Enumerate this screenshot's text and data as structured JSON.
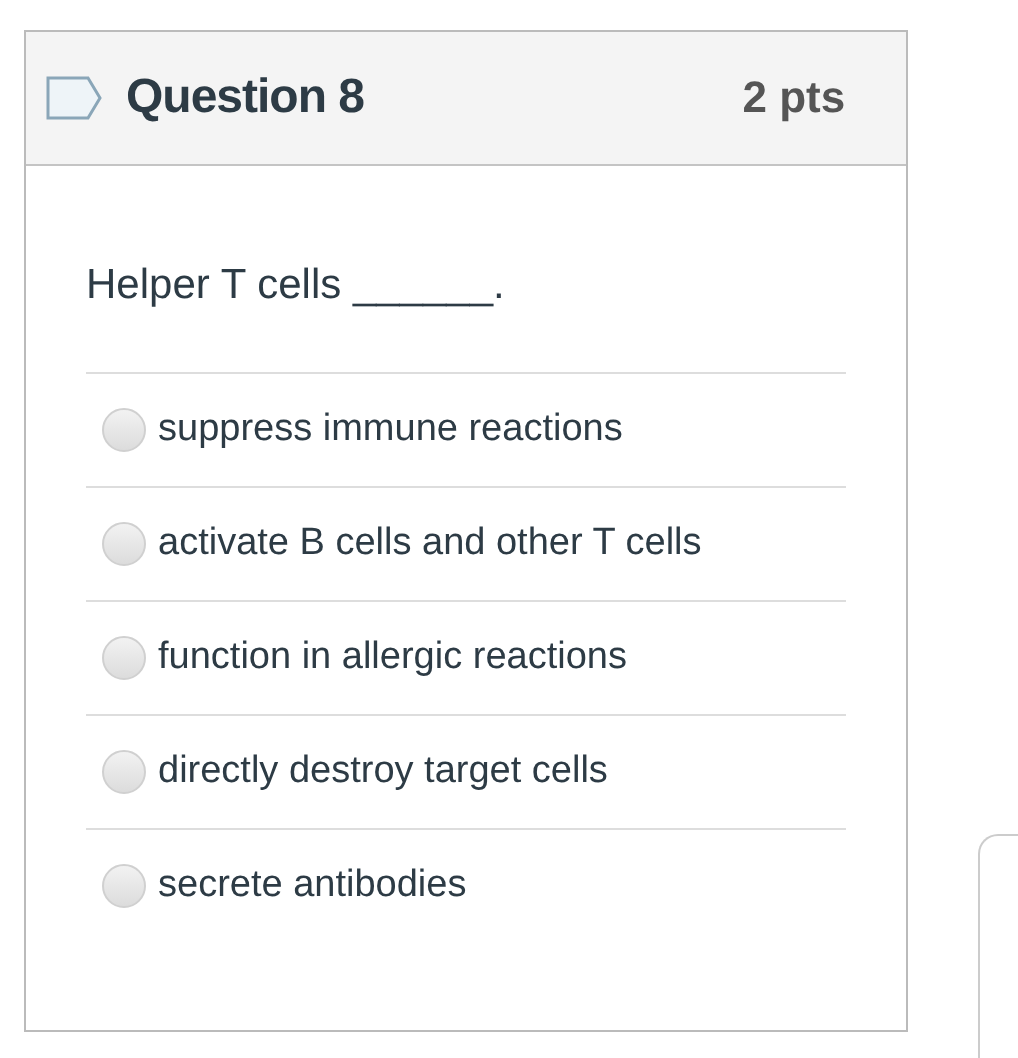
{
  "question": {
    "title": "Question 8",
    "points": "2 pts",
    "flagged": false,
    "prompt": "Helper T cells ______.",
    "options": [
      {
        "label": "suppress immune reactions",
        "selected": false
      },
      {
        "label": "activate B cells and other T cells",
        "selected": false
      },
      {
        "label": "function in allergic reactions",
        "selected": false
      },
      {
        "label": "directly destroy target cells",
        "selected": false
      },
      {
        "label": "secrete antibodies",
        "selected": false
      }
    ]
  }
}
